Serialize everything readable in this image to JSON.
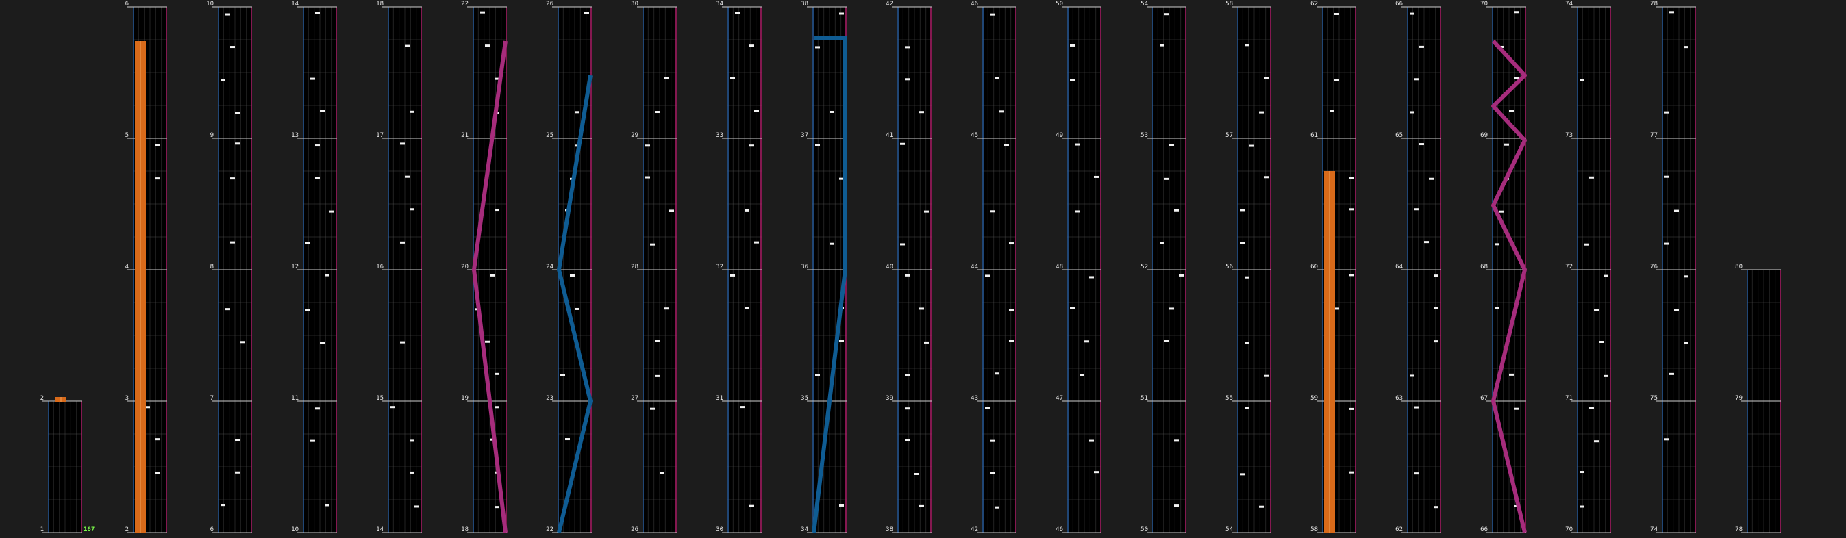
{
  "colors": {
    "background": "#1c1c1c",
    "lane": "#000000",
    "grid": "#4a4a4a",
    "measure_line": "#cfcfcf",
    "left_border": "#2a5d9c",
    "right_border": "#b0206a",
    "note": "#f2f2f2",
    "long_note": "#d86a1a",
    "long_note_stripe": "#f0a05a",
    "scratch_blue": "#0f5c93",
    "scratch_pink": "#a62c7c",
    "number": "#e8e8e8",
    "combo": "#7cfc4a"
  },
  "chart_data": {
    "type": "rhythm-game-chart",
    "columns": [
      {
        "measures": [
          1,
          2
        ]
      },
      {
        "measures": [
          2,
          3,
          4,
          5,
          6
        ]
      },
      {
        "measures": [
          6,
          7,
          8,
          9,
          10
        ]
      },
      {
        "measures": [
          10,
          11,
          12,
          13,
          14
        ]
      },
      {
        "measures": [
          14,
          15,
          16,
          17,
          18
        ]
      },
      {
        "measures": [
          18,
          19,
          20,
          21,
          22
        ]
      },
      {
        "measures": [
          22,
          23,
          24,
          25,
          26
        ]
      },
      {
        "measures": [
          26,
          27,
          28,
          29,
          30
        ]
      },
      {
        "measures": [
          30,
          31,
          32,
          33,
          34
        ]
      },
      {
        "measures": [
          34,
          35,
          36,
          37,
          38
        ]
      },
      {
        "measures": [
          38,
          39,
          40,
          41,
          42
        ]
      },
      {
        "measures": [
          42,
          43,
          44,
          45,
          46
        ]
      },
      {
        "measures": [
          46,
          47,
          48,
          49,
          50
        ]
      },
      {
        "measures": [
          50,
          51,
          52,
          53,
          54
        ]
      },
      {
        "measures": [
          54,
          55,
          56,
          57,
          58
        ]
      },
      {
        "measures": [
          58,
          59,
          60,
          61,
          62
        ]
      },
      {
        "measures": [
          62,
          63,
          64,
          65,
          66
        ]
      },
      {
        "measures": [
          66,
          67,
          68,
          69,
          70
        ]
      },
      {
        "measures": [
          70,
          71,
          72,
          73,
          74
        ]
      },
      {
        "measures": [
          74,
          75,
          76,
          77,
          78
        ]
      },
      {
        "measures": [
          78,
          79,
          80
        ]
      }
    ],
    "combo_total": "167"
  }
}
